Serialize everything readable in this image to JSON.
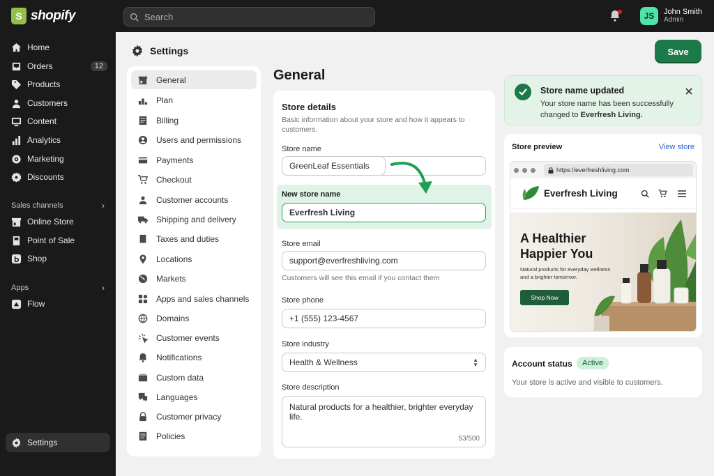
{
  "topbar": {
    "logo_text": "shopify",
    "search_placeholder": "Search",
    "user": {
      "initials": "JS",
      "name": "John Smith",
      "role": "Admin"
    }
  },
  "sidebar": {
    "items": [
      {
        "label": "Home",
        "icon": "home-icon"
      },
      {
        "label": "Orders",
        "icon": "orders-icon",
        "badge": "12"
      },
      {
        "label": "Products",
        "icon": "tag-icon"
      },
      {
        "label": "Customers",
        "icon": "person-icon"
      },
      {
        "label": "Content",
        "icon": "content-icon"
      },
      {
        "label": "Analytics",
        "icon": "analytics-icon"
      },
      {
        "label": "Marketing",
        "icon": "marketing-icon"
      },
      {
        "label": "Discounts",
        "icon": "discount-icon"
      }
    ],
    "sales_channels_label": "Sales channels",
    "channels": [
      {
        "label": "Online Store",
        "icon": "store-icon"
      },
      {
        "label": "Point of Sale",
        "icon": "pos-icon"
      },
      {
        "label": "Shop",
        "icon": "shop-icon"
      }
    ],
    "apps_label": "Apps",
    "apps": [
      {
        "label": "Flow",
        "icon": "flow-icon"
      }
    ],
    "settings_label": "Settings"
  },
  "settings": {
    "title": "Settings",
    "menu": [
      "General",
      "Plan",
      "Billing",
      "Users and permissions",
      "Payments",
      "Checkout",
      "Customer accounts",
      "Shipping and delivery",
      "Taxes and duties",
      "Locations",
      "Markets",
      "Apps and sales channels",
      "Domains",
      "Customer events",
      "Notifications",
      "Custom data",
      "Languages",
      "Customer privacy",
      "Policies"
    ]
  },
  "general": {
    "title": "General",
    "card_title": "Store details",
    "card_desc": "Basic information about your store and how it appears to customers.",
    "store_name_label": "Store name",
    "store_name_value": "GreenLeaf Essentials",
    "new_store_name_label": "New store name",
    "new_store_name_value": "Everfresh Living",
    "store_email_label": "Store email",
    "store_email_value": "support@everfreshliving.com",
    "store_email_hint": "Customers will see this email if you contact them",
    "store_phone_label": "Store phone",
    "store_phone_value": "+1 (555) 123-4567",
    "store_industry_label": "Store industry",
    "store_industry_value": "Health & Wellness",
    "store_description_label": "Store description",
    "store_description_value": "Natural products for a healthier, brighter everyday life.",
    "store_description_count": "53/500"
  },
  "save_label": "Save",
  "toast": {
    "title": "Store name updated",
    "body_prefix": "Your store name has been successfully changed to ",
    "body_name": "Everfresh Living.",
    "accent": "#1b7a48"
  },
  "preview": {
    "title": "Store preview",
    "view_store": "View store",
    "url": "https://everfreshliving.com",
    "store_name": "Everfresh Living",
    "hero_title": "A Healthier Happier You",
    "hero_sub": "Natural products for everyday wellness and a brighter tomorrow.",
    "hero_button": "Shop Now"
  },
  "account": {
    "title": "Account status",
    "badge": "Active",
    "desc": "Your store is active and visible to customers."
  }
}
